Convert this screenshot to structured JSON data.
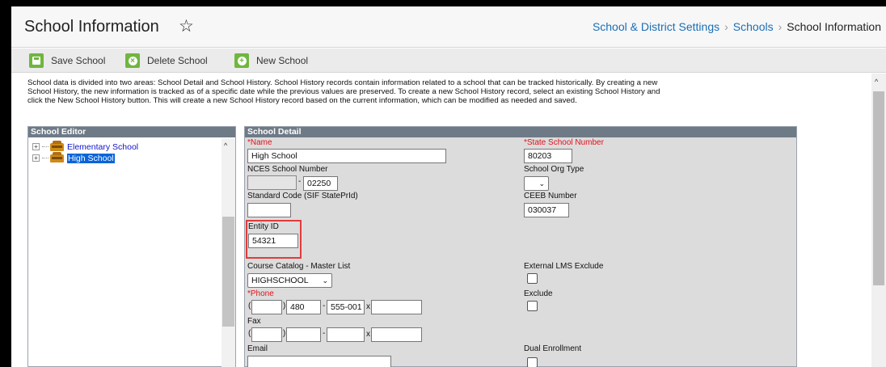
{
  "header": {
    "title": "School Information",
    "star_icon": "star-outline-icon",
    "breadcrumb": [
      "School & District Settings",
      "Schools",
      "School Information"
    ]
  },
  "toolbar": {
    "save_label": "Save School",
    "delete_label": "Delete School",
    "new_label": "New School",
    "accent_color": "#70b63f"
  },
  "intro_text": "School data is divided into two areas: School Detail and School History. School History records contain information related to a school that can be tracked historically. By creating a new School History, the new information is tracked as of a specific date while the previous values are preserved. To create a new School History record, select an existing School History and click the New School History button. This will create a new School History record based on the current information, which can be modified as needed and saved.",
  "editor": {
    "header": "School Editor",
    "items": [
      {
        "label": "Elementary School",
        "selected": false
      },
      {
        "label": "High School",
        "selected": true
      }
    ]
  },
  "detail": {
    "header": "School Detail",
    "name_label": "*Name",
    "name_value": "High School",
    "state_number_label": "*State School Number",
    "state_number_value": "80203",
    "nces_label": "NCES School Number",
    "nces_part1": "",
    "nces_part2": "02250",
    "org_type_label": "School Org Type",
    "org_type_value": "",
    "standard_code_label": "Standard Code (SIF StatePrId)",
    "standard_code_value": "",
    "ceeb_label": "CEEB Number",
    "ceeb_value": "030037",
    "entity_id_label": "Entity ID",
    "entity_id_value": "54321",
    "catalog_label": "Course Catalog - Master List",
    "catalog_value": "HIGHSCHOOL",
    "external_lms_label": "External LMS Exclude",
    "phone_label": "*Phone",
    "phone_area": "",
    "phone_prefix": "480",
    "phone_line": "555-001",
    "phone_ext": "",
    "exclude_label": "Exclude",
    "fax_label": "Fax",
    "email_label": "Email",
    "email_value": "",
    "dual_enrollment_label": "Dual Enrollment"
  }
}
